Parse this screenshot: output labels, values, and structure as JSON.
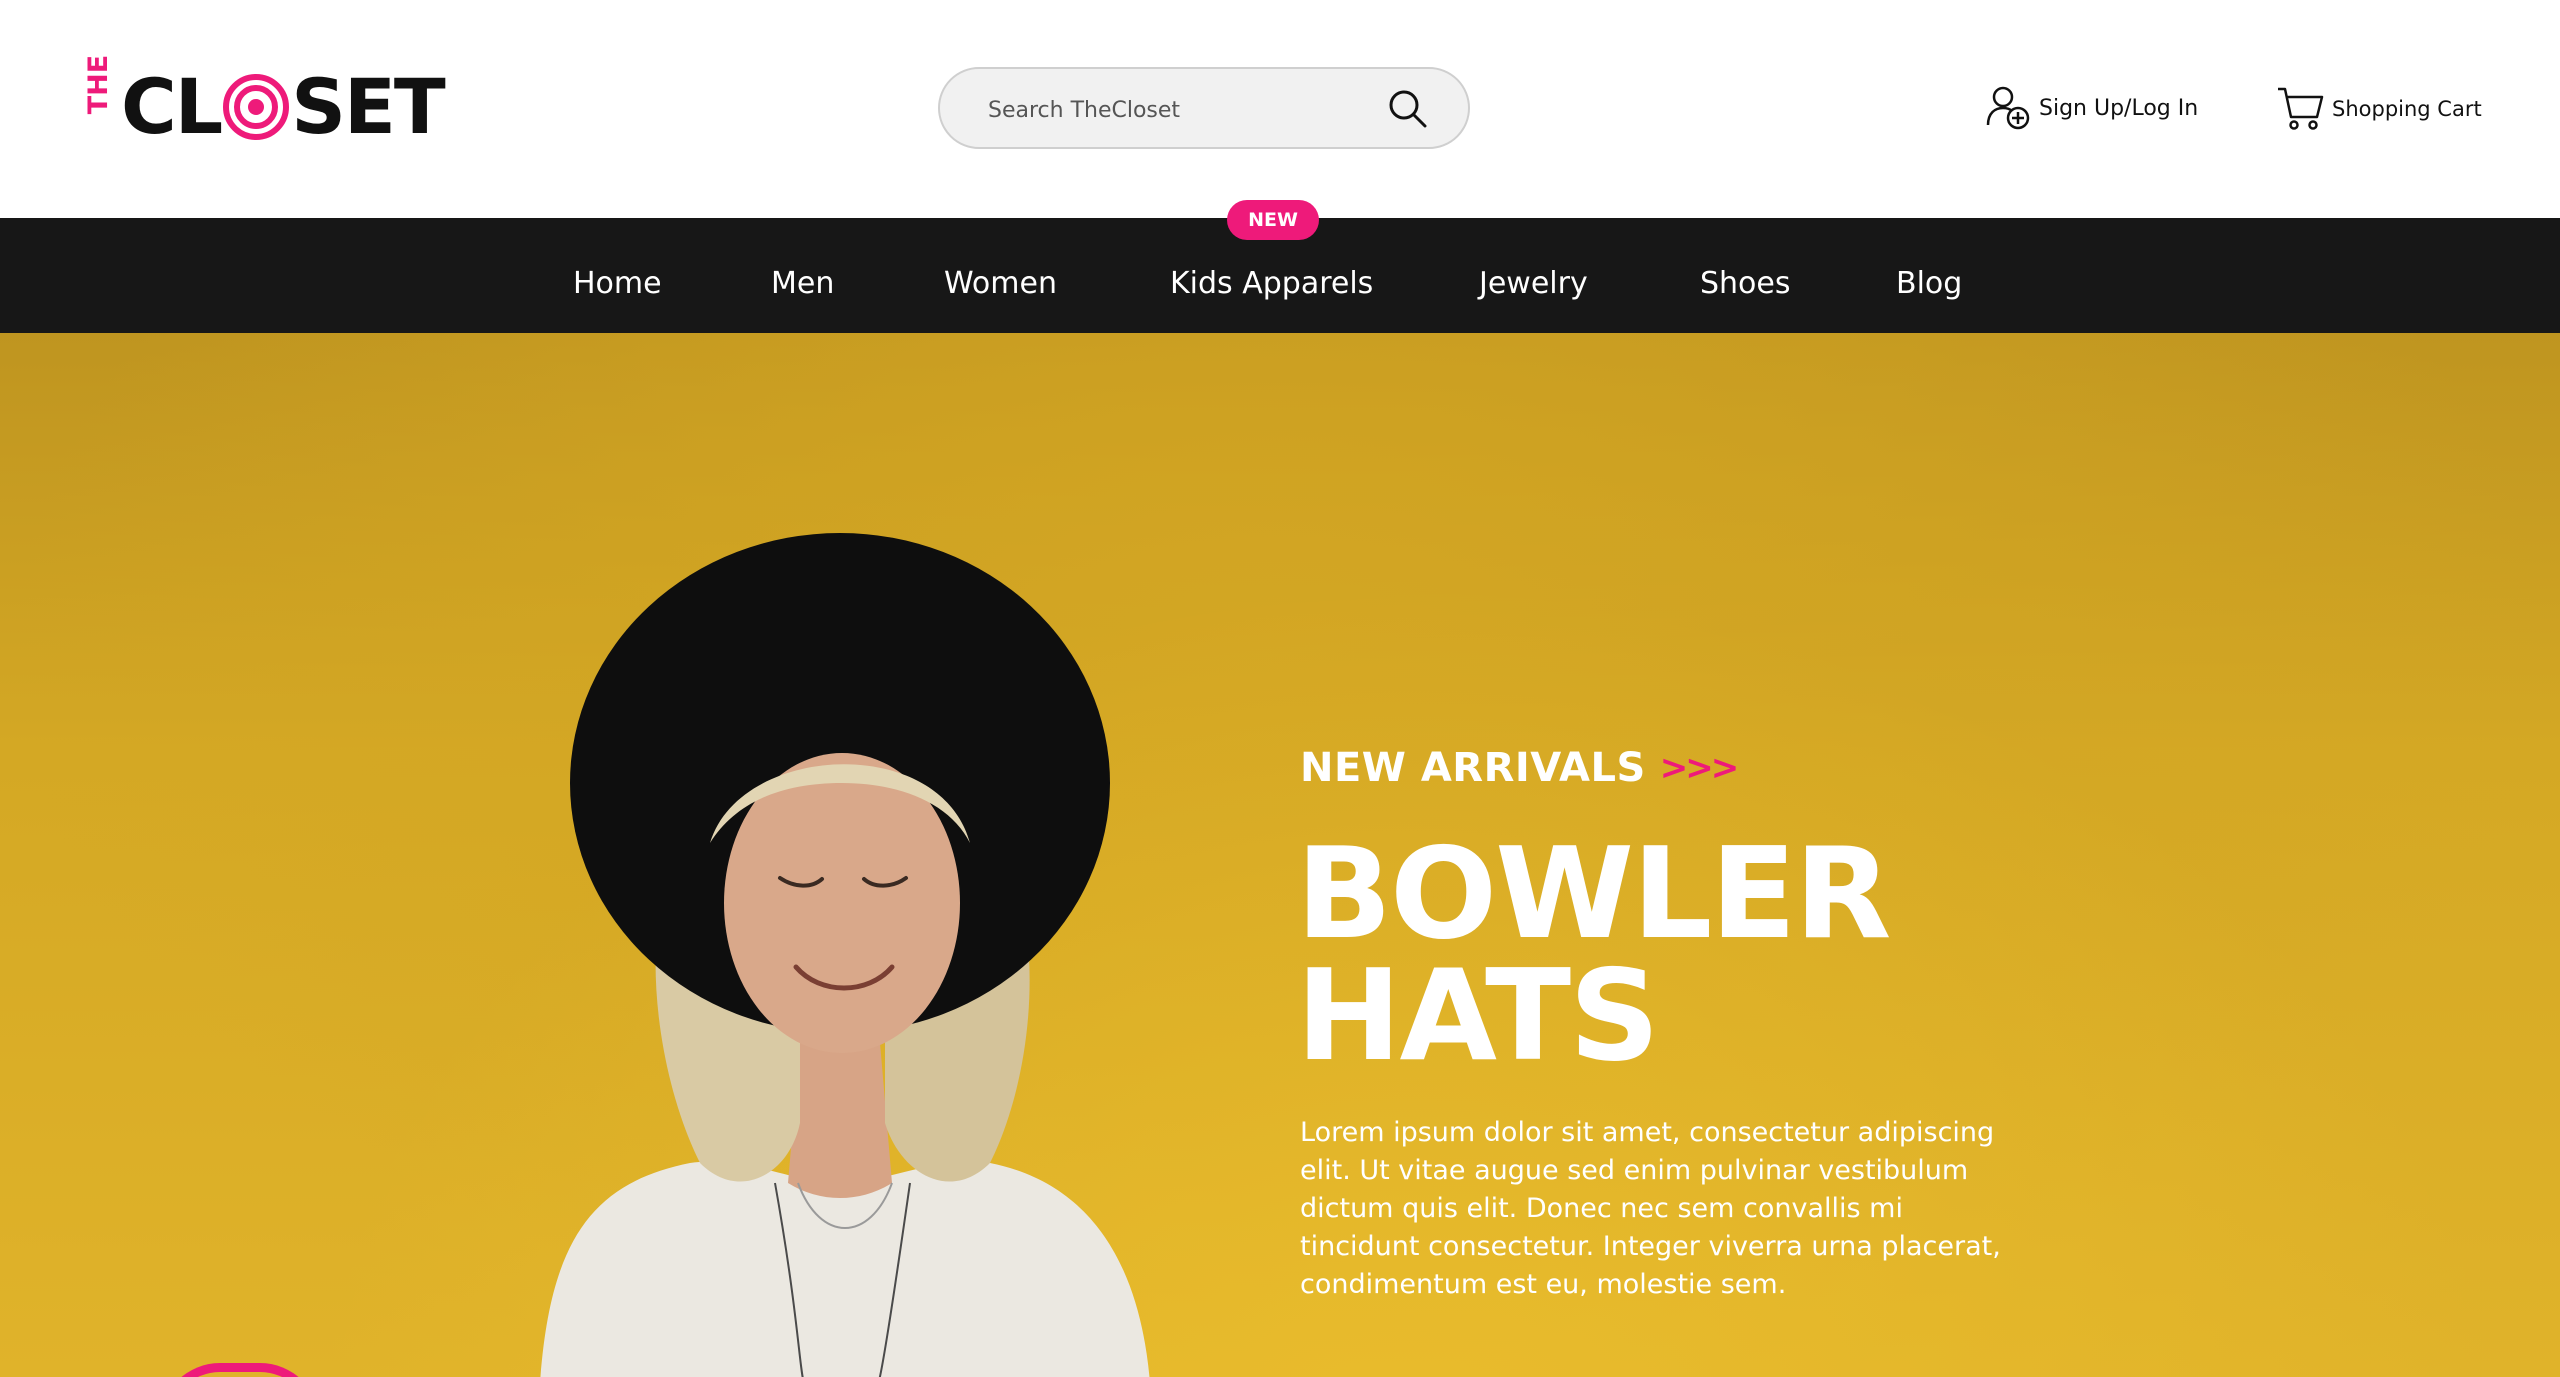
{
  "logo": {
    "prefix": "THE",
    "word_start": "CL",
    "word_end": "SET"
  },
  "search": {
    "placeholder": "Search TheCloset"
  },
  "account": {
    "label": "Sign Up/Log In"
  },
  "cart": {
    "label": "Shopping Cart"
  },
  "nav": {
    "badge": "NEW",
    "items": [
      "Home",
      "Men",
      "Women",
      "Kids Apparels",
      "Jewelry",
      "Shoes",
      "Blog"
    ]
  },
  "hero": {
    "eyebrow": "NEW ARRIVALS",
    "eyebrow_arrows": ">>>",
    "headline_line1": "BOWLER",
    "headline_line2": "HATS",
    "body": "Lorem ipsum dolor sit amet, consectetur adipiscing elit. Ut vitae augue sed enim pulvinar vestibulum dictum quis elit. Donec nec sem convallis mi tincidunt consectetur. Integer viverra urna placerat, condimentum est eu, molestie sem."
  },
  "colors": {
    "accent": "#ee1a7a",
    "nav_bg": "#171717",
    "hero_bg": "#d9ad27",
    "text": "#111111"
  },
  "icons": [
    "target-logo-icon",
    "search-icon",
    "user-add-icon",
    "shopping-cart-icon"
  ]
}
